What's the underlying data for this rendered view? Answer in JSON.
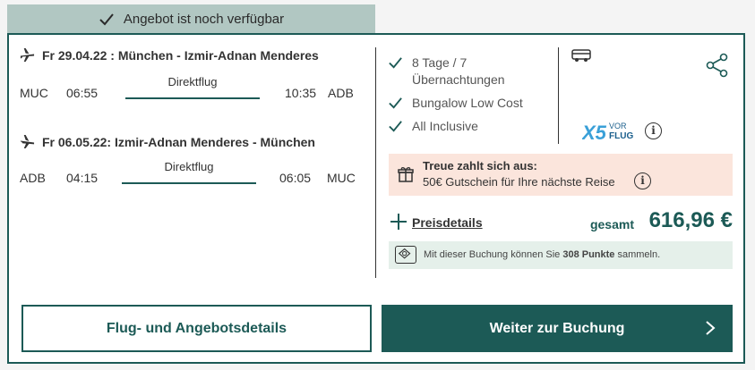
{
  "banner": {
    "text": "Angebot ist noch verfügbar"
  },
  "outbound": {
    "heading": "Fr 29.04.22 : München - Izmir-Adnan Menderes",
    "dep_code": "MUC",
    "dep_time": "06:55",
    "type": "Direktflug",
    "arr_time": "10:35",
    "arr_code": "ADB"
  },
  "inbound": {
    "heading": "Fr 06.05.22: Izmir-Adnan Menderes - München",
    "dep_code": "ADB",
    "dep_time": "04:15",
    "type": "Direktflug",
    "arr_time": "06:05",
    "arr_code": "MUC"
  },
  "features": [
    "8 Tage / 7 Übernachtungen",
    "Bungalow Low Cost",
    "All Inclusive"
  ],
  "feature_lines": {
    "f0a": "8 Tage / 7",
    "f0b": "Übernachtungen"
  },
  "brand": {
    "logo_text_a": "X5",
    "logo_text_b": "VOR",
    "logo_text_c": "FLUG"
  },
  "promo": {
    "title": "Treue zahlt sich aus:",
    "text": "50€ Gutschein für Ihre nächste Reise",
    "info": "i"
  },
  "pricing": {
    "details_label": "Preisdetails",
    "total_label": "gesamt",
    "price": "616,96 €"
  },
  "points": {
    "prefix": "Mit dieser Buchung können Sie ",
    "amount": "308 Punkte",
    "suffix": " sammeln."
  },
  "buttons": {
    "details": "Flug- und Angebotsdetails",
    "book": "Weiter zur Buchung"
  },
  "info_glyph": "i",
  "colors": {
    "primary": "#1c5a56",
    "banner": "#b1c7c2",
    "promo_bg": "#fbe5dc",
    "points_bg": "#e5f0ea"
  }
}
